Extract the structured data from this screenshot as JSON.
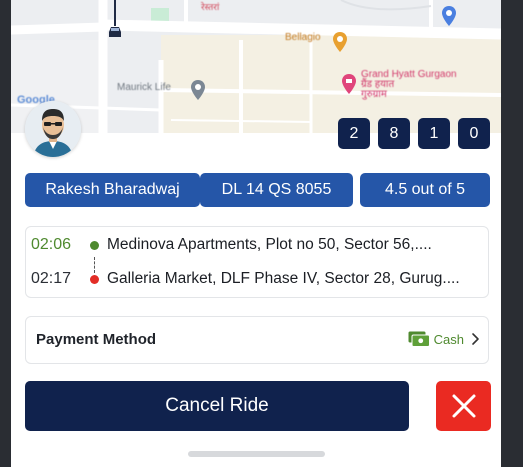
{
  "map": {
    "place_labels": {
      "mall": "Bellagio",
      "hotel_line1": "Grand Hyatt Gurgaon",
      "hotel_line2": "ग्रैंड हयात",
      "hotel_line3": "गुरुग्राम",
      "road": "Maurick Life",
      "top_label": "रेस्तरां"
    },
    "attribution": "Google"
  },
  "otp": {
    "digits": [
      "2",
      "8",
      "1",
      "0"
    ]
  },
  "driver": {
    "name": "Rakesh Bharadwaj",
    "vehicle_number": "DL 14 QS 8055",
    "rating": "4.5 out of 5"
  },
  "route": {
    "pickup": {
      "time": "02:06",
      "address": "Medinova Apartments, Plot no 50, Sector 56,...."
    },
    "drop": {
      "time": "02:17",
      "address": "Galleria Market, DLF Phase IV, Sector 28, Gurug...."
    }
  },
  "payment": {
    "label": "Payment Method",
    "method": "Cash"
  },
  "actions": {
    "cancel_label": "Cancel Ride"
  },
  "colors": {
    "primary_navy": "#10224d",
    "chip_blue": "#2556a8",
    "danger_red": "#ea2a22",
    "pickup_green": "#4f8a2f",
    "drop_red": "#e32d26"
  }
}
